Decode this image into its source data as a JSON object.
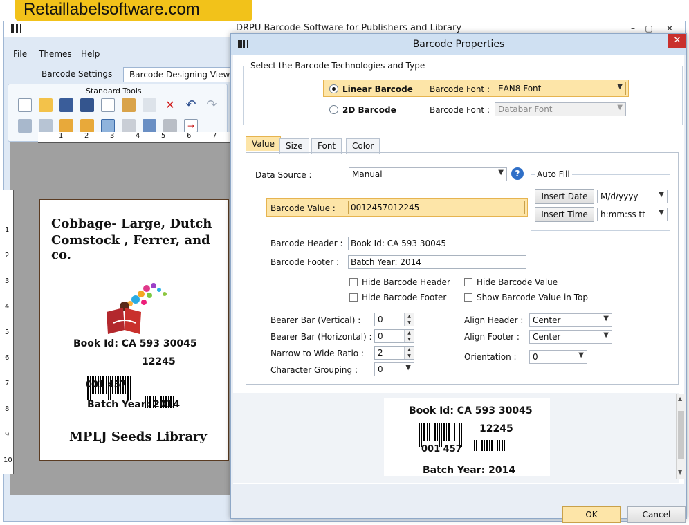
{
  "brand": {
    "text": "Retaillabelsoftware.com"
  },
  "main_window": {
    "title": "DRPU Barcode Software for Publishers and Library",
    "window_buttons": [
      "–",
      "▢",
      "✕"
    ],
    "menu": [
      "File",
      "Themes",
      "Help"
    ],
    "ribbon_tabs": [
      "Barcode Settings",
      "Barcode Designing View"
    ],
    "standard_tools_label": "Standard Tools",
    "ruler_top": [
      "1",
      "2",
      "3",
      "4",
      "5",
      "6",
      "7"
    ],
    "ruler_left": [
      "1",
      "2",
      "3",
      "4",
      "5",
      "6",
      "7",
      "8",
      "9",
      "10"
    ]
  },
  "label_preview": {
    "line1": "Cobbage- Large, Dutch",
    "line2": "Comstock , Ferrer, and co.",
    "book_id": "Book Id: CA 593 30045",
    "barcode_number": "12245",
    "left_number": "001 457",
    "batch_year": "Batch Year: 2014",
    "footer": "MPLJ Seeds Library"
  },
  "dialog": {
    "title": "Barcode Properties",
    "close": "✕",
    "tech_group_title": "Select the Barcode Technologies and Type",
    "linear_label": "Linear Barcode",
    "linear_font_label": "Barcode Font :",
    "linear_font_value": "EAN8 Font",
    "twod_label": "2D Barcode",
    "twod_font_label": "Barcode Font :",
    "twod_font_value": "Databar Font",
    "tabs": [
      "Value",
      "Size",
      "Font",
      "Color"
    ],
    "data_source_label": "Data Source :",
    "data_source_value": "Manual",
    "help_icon": "?",
    "auto_fill_title": "Auto Fill",
    "insert_date_label": "Insert Date",
    "insert_date_format": "M/d/yyyy",
    "insert_time_label": "Insert Time",
    "insert_time_format": "h:mm:ss tt",
    "barcode_value_label": "Barcode Value :",
    "barcode_value": "0012457012245",
    "header_label": "Barcode Header :",
    "header_value": "Book Id: CA 593 30045",
    "footer_label": "Barcode Footer :",
    "footer_value": "Batch Year: 2014",
    "hide_header": "Hide Barcode Header",
    "hide_footer": "Hide Barcode Footer",
    "hide_value": "Hide Barcode Value",
    "show_value_top": "Show Barcode Value in Top",
    "bearer_vertical_label": "Bearer Bar (Vertical) :",
    "bearer_vertical_value": "0",
    "bearer_horizontal_label": "Bearer Bar (Horizontal) :",
    "bearer_horizontal_value": "0",
    "narrow_wide_label": "Narrow to Wide Ratio :",
    "narrow_wide_value": "2",
    "char_grouping_label": "Character Grouping :",
    "char_grouping_value": "0",
    "align_header_label": "Align Header :",
    "align_header_value": "Center",
    "align_footer_label": "Align Footer :",
    "align_footer_value": "Center",
    "orientation_label": "Orientation :",
    "orientation_value": "0",
    "preview": {
      "book_id": "Book Id: CA 593 30045",
      "barcode_number": "12245",
      "left_number": "001 457",
      "batch_year": "Batch Year: 2014"
    },
    "ok": "OK",
    "cancel": "Cancel"
  }
}
